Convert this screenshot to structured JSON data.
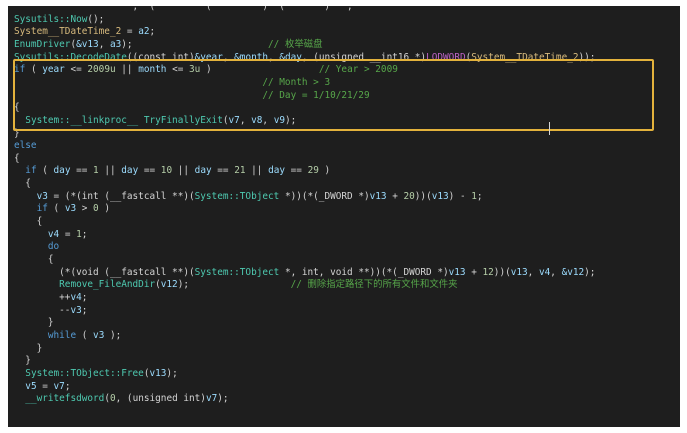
{
  "editor": {
    "lines": [
      [
        {
          "t": "                     ,  (         (         )  (       )   , ",
          "c": "default"
        }
      ],
      [
        {
          "t": "Sysutils::Now",
          "c": "func"
        },
        {
          "t": "();",
          "c": "default"
        }
      ],
      [
        {
          "t": "System__TDateTime_2",
          "c": "global"
        },
        {
          "t": " = ",
          "c": "default"
        },
        {
          "t": "a2",
          "c": "var"
        },
        {
          "t": ";",
          "c": "default"
        }
      ],
      [
        {
          "t": "EnumDriver",
          "c": "func"
        },
        {
          "t": "(",
          "c": "default"
        },
        {
          "t": "&v13",
          "c": "var"
        },
        {
          "t": ", ",
          "c": "default"
        },
        {
          "t": "a3",
          "c": "var"
        },
        {
          "t": ");                        ",
          "c": "default"
        },
        {
          "t": "// 枚举磁盘",
          "c": "comment"
        }
      ],
      [
        {
          "t": "Sysutils::DecodeDate",
          "c": "func"
        },
        {
          "t": "((const int)",
          "c": "default"
        },
        {
          "t": "&year",
          "c": "var"
        },
        {
          "t": ", ",
          "c": "default"
        },
        {
          "t": "&month",
          "c": "var"
        },
        {
          "t": ", ",
          "c": "default"
        },
        {
          "t": "&day",
          "c": "var"
        },
        {
          "t": ", (unsigned __int16 *)",
          "c": "default"
        },
        {
          "t": "LODWORD",
          "c": "macro"
        },
        {
          "t": "(",
          "c": "default"
        },
        {
          "t": "System__TDateTime_2",
          "c": "global"
        },
        {
          "t": "));",
          "c": "default"
        }
      ],
      [
        {
          "t": "if",
          "c": "keyword"
        },
        {
          "t": " ( ",
          "c": "default"
        },
        {
          "t": "year",
          "c": "var"
        },
        {
          "t": " <= ",
          "c": "default"
        },
        {
          "t": "2009u",
          "c": "number"
        },
        {
          "t": " || ",
          "c": "default"
        },
        {
          "t": "month",
          "c": "var"
        },
        {
          "t": " <= ",
          "c": "default"
        },
        {
          "t": "3u",
          "c": "number"
        },
        {
          "t": " )                   ",
          "c": "default"
        },
        {
          "t": "// Year > 2009",
          "c": "comment"
        }
      ],
      [
        {
          "t": "                                            ",
          "c": "default"
        },
        {
          "t": "// Month > 3",
          "c": "comment"
        }
      ],
      [
        {
          "t": "                                            ",
          "c": "default"
        },
        {
          "t": "// Day = 1/10/21/29",
          "c": "comment"
        }
      ],
      [
        {
          "t": "{",
          "c": "default"
        }
      ],
      [
        {
          "t": "  ",
          "c": "default"
        },
        {
          "t": "System::__linkproc__ TryFinallyExit",
          "c": "func"
        },
        {
          "t": "(",
          "c": "default"
        },
        {
          "t": "v7",
          "c": "var"
        },
        {
          "t": ", ",
          "c": "default"
        },
        {
          "t": "v8",
          "c": "var"
        },
        {
          "t": ", ",
          "c": "default"
        },
        {
          "t": "v9",
          "c": "var"
        },
        {
          "t": ");",
          "c": "default"
        }
      ],
      [
        {
          "t": "}",
          "c": "default"
        }
      ],
      [
        {
          "t": "else",
          "c": "keyword"
        }
      ],
      [
        {
          "t": "{",
          "c": "default"
        }
      ],
      [
        {
          "t": "  ",
          "c": "default"
        },
        {
          "t": "if",
          "c": "keyword"
        },
        {
          "t": " ( ",
          "c": "default"
        },
        {
          "t": "day",
          "c": "var"
        },
        {
          "t": " == ",
          "c": "default"
        },
        {
          "t": "1",
          "c": "number"
        },
        {
          "t": " || ",
          "c": "default"
        },
        {
          "t": "day",
          "c": "var"
        },
        {
          "t": " == ",
          "c": "default"
        },
        {
          "t": "10",
          "c": "number"
        },
        {
          "t": " || ",
          "c": "default"
        },
        {
          "t": "day",
          "c": "var"
        },
        {
          "t": " == ",
          "c": "default"
        },
        {
          "t": "21",
          "c": "number"
        },
        {
          "t": " || ",
          "c": "default"
        },
        {
          "t": "day",
          "c": "var"
        },
        {
          "t": " == ",
          "c": "default"
        },
        {
          "t": "29",
          "c": "number"
        },
        {
          "t": " )",
          "c": "default"
        }
      ],
      [
        {
          "t": "  {",
          "c": "default"
        }
      ],
      [
        {
          "t": "    ",
          "c": "default"
        },
        {
          "t": "v3",
          "c": "var"
        },
        {
          "t": " = (*(int (__fastcall **)(",
          "c": "default"
        },
        {
          "t": "System::TObject",
          "c": "func"
        },
        {
          "t": " *))(*(_DWORD *)",
          "c": "default"
        },
        {
          "t": "v13",
          "c": "var"
        },
        {
          "t": " + ",
          "c": "default"
        },
        {
          "t": "20",
          "c": "number"
        },
        {
          "t": "))(",
          "c": "default"
        },
        {
          "t": "v13",
          "c": "var"
        },
        {
          "t": ") - ",
          "c": "default"
        },
        {
          "t": "1",
          "c": "number"
        },
        {
          "t": ";",
          "c": "default"
        }
      ],
      [
        {
          "t": "    ",
          "c": "default"
        },
        {
          "t": "if",
          "c": "keyword"
        },
        {
          "t": " ( ",
          "c": "default"
        },
        {
          "t": "v3",
          "c": "var"
        },
        {
          "t": " > ",
          "c": "default"
        },
        {
          "t": "0",
          "c": "number"
        },
        {
          "t": " )",
          "c": "default"
        }
      ],
      [
        {
          "t": "    {",
          "c": "default"
        }
      ],
      [
        {
          "t": "      ",
          "c": "default"
        },
        {
          "t": "v4",
          "c": "var"
        },
        {
          "t": " = ",
          "c": "default"
        },
        {
          "t": "1",
          "c": "number"
        },
        {
          "t": ";",
          "c": "default"
        }
      ],
      [
        {
          "t": "      ",
          "c": "default"
        },
        {
          "t": "do",
          "c": "keyword"
        }
      ],
      [
        {
          "t": "      {",
          "c": "default"
        }
      ],
      [
        {
          "t": "        (*(void (__fastcall **)(",
          "c": "default"
        },
        {
          "t": "System::TObject",
          "c": "func"
        },
        {
          "t": " *, int, void **))(*(_DWORD *)",
          "c": "default"
        },
        {
          "t": "v13",
          "c": "var"
        },
        {
          "t": " + ",
          "c": "default"
        },
        {
          "t": "12",
          "c": "number"
        },
        {
          "t": "))(",
          "c": "default"
        },
        {
          "t": "v13",
          "c": "var"
        },
        {
          "t": ", ",
          "c": "default"
        },
        {
          "t": "v4",
          "c": "var"
        },
        {
          "t": ", ",
          "c": "default"
        },
        {
          "t": "&v12",
          "c": "var"
        },
        {
          "t": ");",
          "c": "default"
        }
      ],
      [
        {
          "t": "        ",
          "c": "default"
        },
        {
          "t": "Remove_FileAndDir",
          "c": "func"
        },
        {
          "t": "(",
          "c": "default"
        },
        {
          "t": "v12",
          "c": "var"
        },
        {
          "t": ");                  ",
          "c": "default"
        },
        {
          "t": "// 删除指定路径下的所有文件和文件夹",
          "c": "comment"
        }
      ],
      [
        {
          "t": "        ++",
          "c": "default"
        },
        {
          "t": "v4",
          "c": "var"
        },
        {
          "t": ";",
          "c": "default"
        }
      ],
      [
        {
          "t": "        --",
          "c": "default"
        },
        {
          "t": "v3",
          "c": "var"
        },
        {
          "t": ";",
          "c": "default"
        }
      ],
      [
        {
          "t": "      }",
          "c": "default"
        }
      ],
      [
        {
          "t": "      ",
          "c": "default"
        },
        {
          "t": "while",
          "c": "keyword"
        },
        {
          "t": " ( ",
          "c": "default"
        },
        {
          "t": "v3",
          "c": "var"
        },
        {
          "t": " );",
          "c": "default"
        }
      ],
      [
        {
          "t": "    }",
          "c": "default"
        }
      ],
      [
        {
          "t": "  }",
          "c": "default"
        }
      ],
      [
        {
          "t": "  ",
          "c": "default"
        },
        {
          "t": "System::TObject::Free",
          "c": "func"
        },
        {
          "t": "(",
          "c": "default"
        },
        {
          "t": "v13",
          "c": "var"
        },
        {
          "t": ");",
          "c": "default"
        }
      ],
      [
        {
          "t": "  ",
          "c": "default"
        },
        {
          "t": "v5",
          "c": "var"
        },
        {
          "t": " = ",
          "c": "default"
        },
        {
          "t": "v7",
          "c": "var"
        },
        {
          "t": ";",
          "c": "default"
        }
      ],
      [
        {
          "t": "  ",
          "c": "default"
        },
        {
          "t": "__writefsdword",
          "c": "func"
        },
        {
          "t": "(",
          "c": "default"
        },
        {
          "t": "0",
          "c": "number"
        },
        {
          "t": ", (unsigned int)",
          "c": "default"
        },
        {
          "t": "v7",
          "c": "var"
        },
        {
          "t": ");",
          "c": "default"
        }
      ]
    ]
  },
  "colors": {
    "background": "#1e1e1e",
    "highlight_border": "#e3b23c"
  }
}
